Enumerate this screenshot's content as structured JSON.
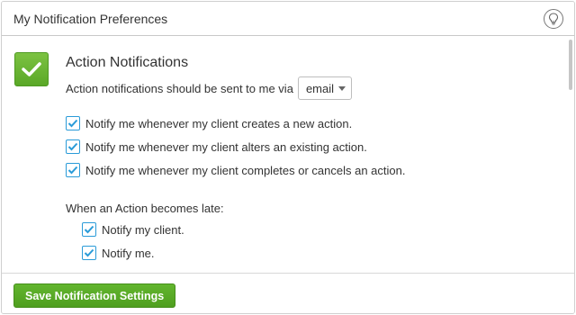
{
  "header": {
    "title": "My Notification Preferences",
    "help_icon": "lightbulb-icon"
  },
  "section": {
    "title": "Action Notifications",
    "check_icon": "checkmark-icon",
    "check_color": "#6bb634",
    "via_text": "Action notifications should be sent to me via",
    "via_select": {
      "selected": "email"
    }
  },
  "options": [
    {
      "label": "Notify me whenever my client creates a new action.",
      "checked": true
    },
    {
      "label": "Notify me whenever my client alters an existing action.",
      "checked": true
    },
    {
      "label": "Notify me whenever my client completes or cancels an action.",
      "checked": true
    }
  ],
  "late": {
    "label": "When an Action becomes late:",
    "options": [
      {
        "label": "Notify my client.",
        "checked": true
      },
      {
        "label": "Notify me.",
        "checked": true
      }
    ]
  },
  "footer": {
    "save_label": "Save Notification Settings",
    "save_color": "#58aa26"
  },
  "colors": {
    "checkbox_border": "#2a9bd8",
    "checkmark": "#2a9bd8"
  }
}
